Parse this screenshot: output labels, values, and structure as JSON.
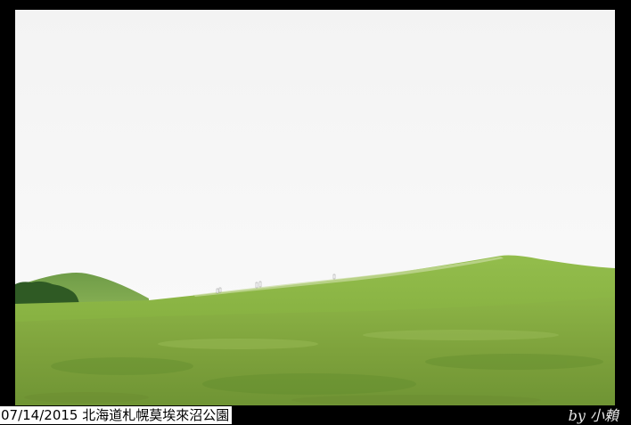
{
  "caption": {
    "text": "07/14/2015 北海道札幌莫埃來沼公園"
  },
  "signature": {
    "text": "by 小賴"
  },
  "photo": {
    "scene": "grassy-hills-under-overcast-sky",
    "colors": {
      "sky": "#f5f5f5",
      "grass_light": "#9cbf52",
      "grass_dark": "#6f9a34",
      "trees": "#2f5a24"
    }
  }
}
